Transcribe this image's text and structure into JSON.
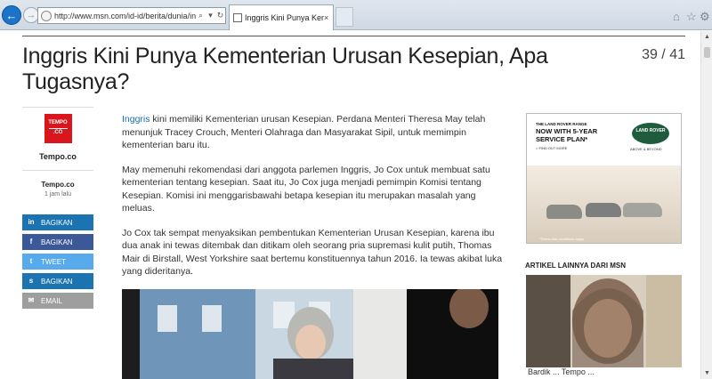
{
  "browser": {
    "url": "http://www.msn.com/id-id/berita/dunia/inggris-kini-",
    "tab_title": "Inggris Kini Punya Kemente...",
    "tab_close": "×"
  },
  "article": {
    "title": "Inggris Kini Punya Kementerian Urusan Kesepian, Apa Tugasnya?",
    "counter": "39 / 41",
    "paragraphs": [
      {
        "link": "Inggris",
        "text": " kini memiliki Kementerian urusan Kesepian. Perdana Menteri Theresa May telah menunjuk Tracey Crouch, Menteri Olahraga dan Masyarakat Sipil, untuk memimpin kementerian baru itu."
      },
      {
        "text": "May memenuhi rekomendasi dari anggota parlemen Inggris, Jo Cox untuk membuat satu kementerian tentang kesepian. Saat itu, Jo Cox juga menjadi pemimpin Komisi tentang Kesepian. Komisi ini menggarisbawahi betapa kesepian itu merupakan masalah yang meluas."
      },
      {
        "text": "Jo Cox tak sempat menyaksikan pembentukan Kementerian Urusan Kesepian, karena ibu dua anak ini tewas ditembak dan ditikam oleh seorang pria supremasi kulit putih, Thomas Mair di Birstall, West Yorkshire saat bertemu konstituennya tahun 2016. Ia tewas akibat luka yang dideritanya."
      }
    ]
  },
  "source": {
    "logo_line1": "TEMPO",
    "logo_line2": ".CO",
    "name_top": "Tempo.co",
    "name": "Tempo.co",
    "time": "1 jam lalu"
  },
  "share": [
    {
      "label": "BAGIKAN",
      "icon": "in"
    },
    {
      "label": "BAGIKAN",
      "icon": "f"
    },
    {
      "label": "TWEET",
      "icon": "t"
    },
    {
      "label": "BAGIKAN",
      "icon": "s"
    },
    {
      "label": "EMAIL",
      "icon": "✉"
    }
  ],
  "ad": {
    "line1": "THE LAND ROVER RANGE",
    "line2": "NOW WITH 5-YEAR SERVICE PLAN*",
    "line3": "> FIND OUT MORE",
    "badge": "LAND ROVER",
    "tagline": "ABOVE & BEYOND",
    "footnote": "*Terms and conditions apply"
  },
  "sidebar": {
    "more_heading": "ARTIKEL LAINNYA DARI MSN",
    "card_caption": "Bardik ... Tempo ..."
  }
}
